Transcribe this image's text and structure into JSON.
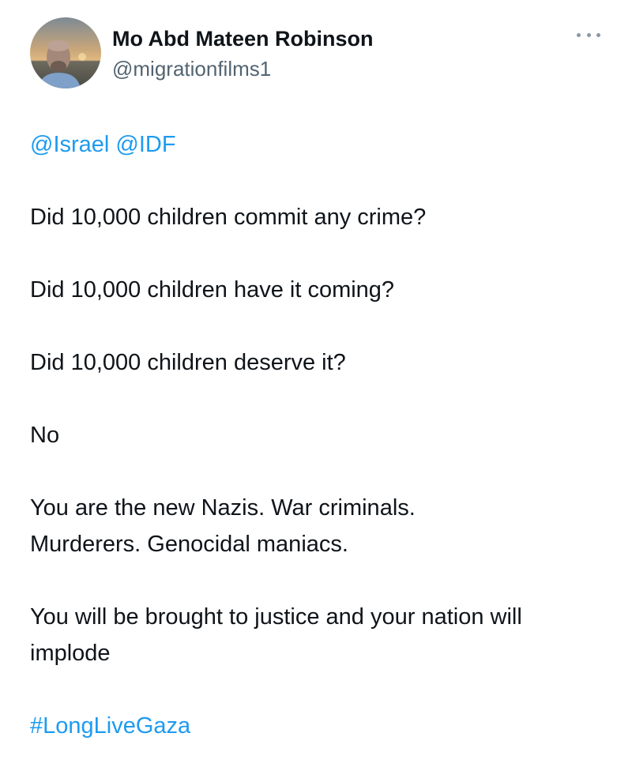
{
  "user": {
    "display_name": "Mo Abd Mateen Robinson",
    "handle": "@migrationfilms1",
    "avatar_icon": "user-avatar-photo"
  },
  "menu": {
    "more_icon": "more-options-icon"
  },
  "tweet": {
    "mentions": [
      "@Israel",
      "@IDF"
    ],
    "lines": [
      "Did 10,000 children commit any crime?",
      "Did 10,000 children have it coming?",
      "Did 10,000 children deserve it?",
      "No",
      "You are the new Nazis. War criminals. Murderers. Genocidal maniacs.",
      "You will be brought to justice and your nation will implode"
    ],
    "hashtag": "#LongLiveGaza"
  },
  "colors": {
    "link": "#1d9bf0",
    "text": "#0f1419",
    "secondary": "#536471"
  }
}
